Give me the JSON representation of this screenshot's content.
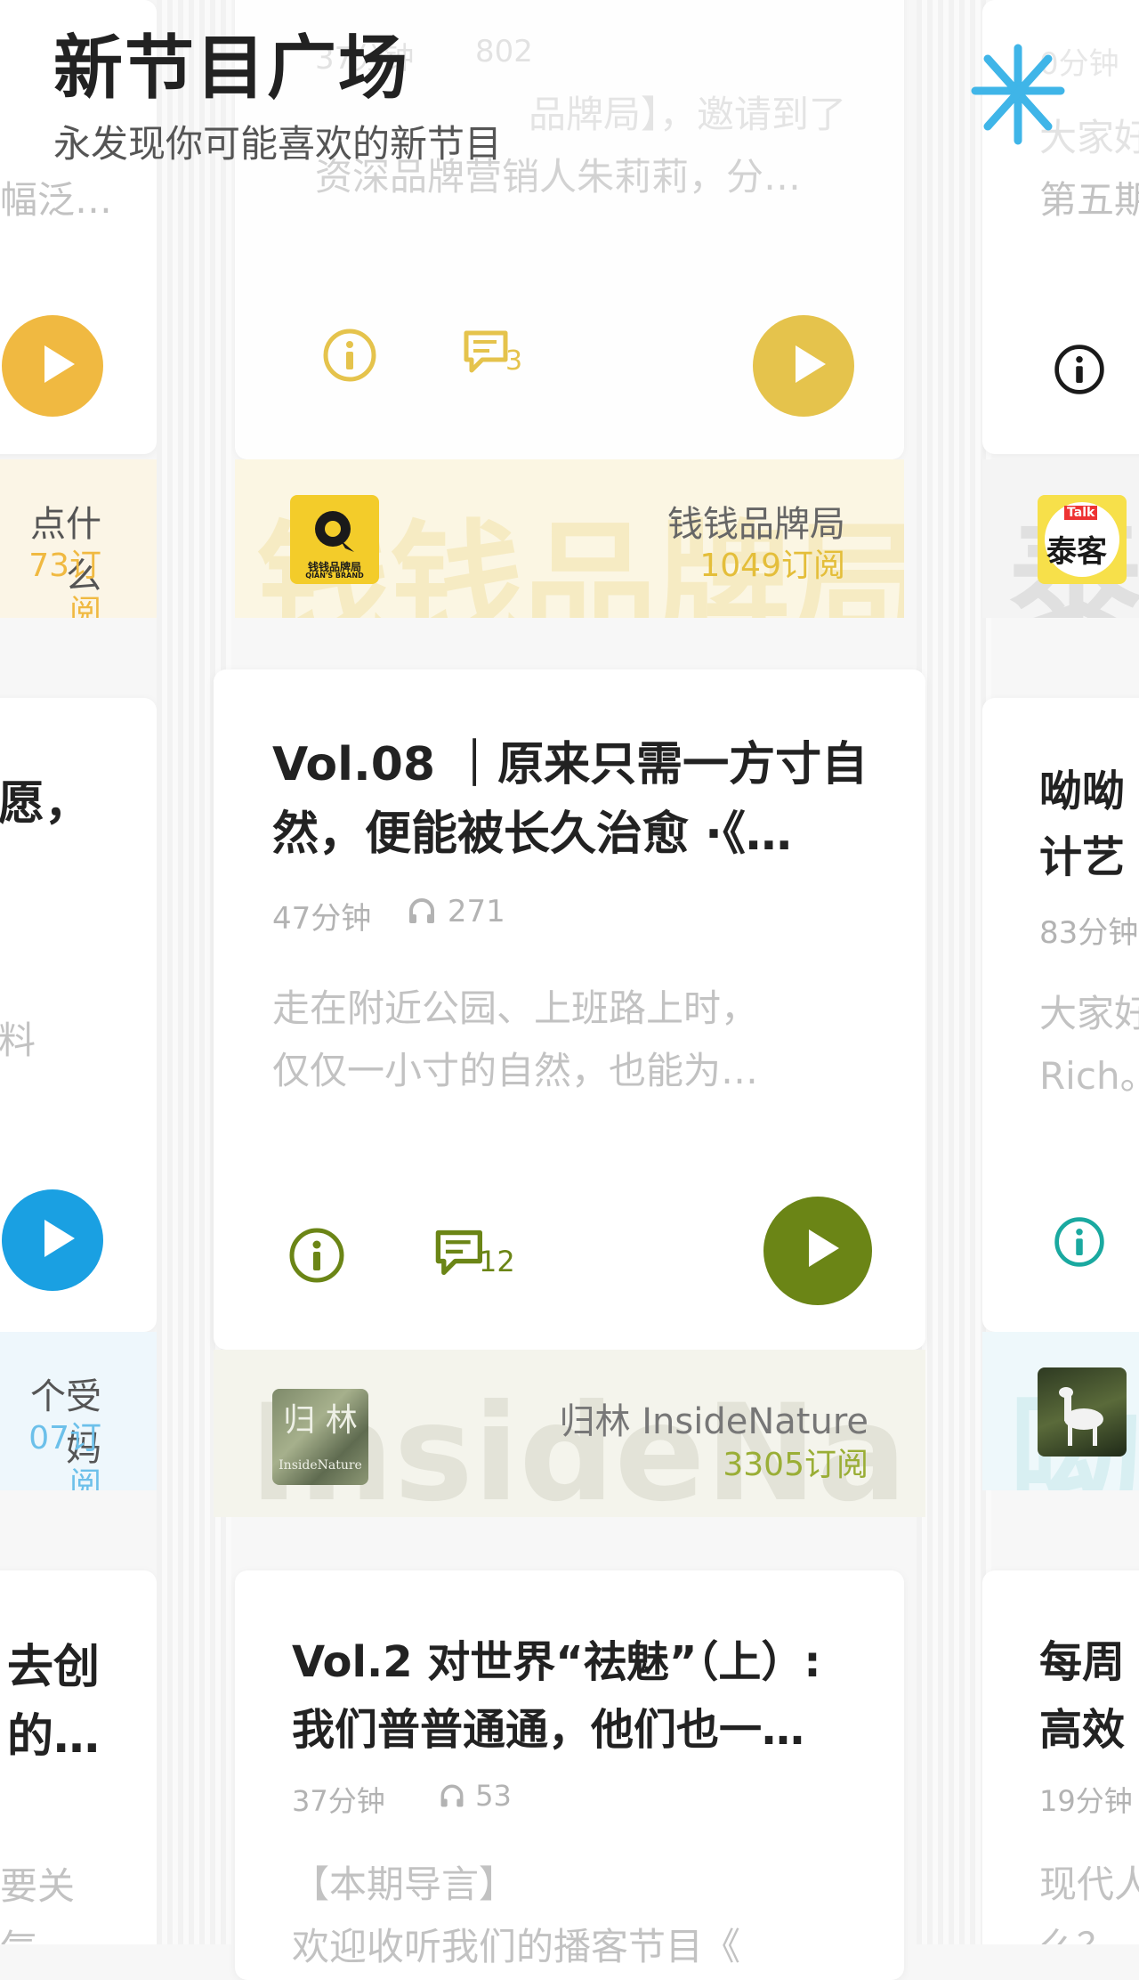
{
  "header": {
    "title": "新节目广场",
    "subtitle": "永发现你可能喜欢的新节目",
    "logo_icon": "asterisk-icon"
  },
  "colors": {
    "yellow_brand": "#e4be3a",
    "orange_play": "#f0b941",
    "olive_brand": "#6b8516",
    "blue_play": "#1aa0e2",
    "teal_icon": "#1aa9a0",
    "logo_blue": "#3fb5e8"
  },
  "center_column": {
    "top_card": {
      "meta_duration": "37分钟",
      "meta_plays": "802",
      "desc_line1": "品牌局】，邀请到了",
      "desc_line2": "资深品牌营销人朱莉莉，分…",
      "comments": "3"
    },
    "podcast1": {
      "name": "钱钱品牌局",
      "subs": "1049订阅",
      "watermark": "钱钱品牌局",
      "cover_label": "钱钱品牌局",
      "cover_sub": "QIAN'S BRAND"
    },
    "card1": {
      "title_line1": "Vol.08 ｜原来只需一方寸自",
      "title_line2": "然，便能被长久治愈 ·《…",
      "duration": "47分钟",
      "plays": "271",
      "desc_line1": "走在附近公园、上班路上时，",
      "desc_line2": "仅仅一小寸的自然，也能为…",
      "comments": "12"
    },
    "podcast2": {
      "name": "归林 InsideNature",
      "subs": "3305订阅",
      "watermark": "InsideNa",
      "cover_label": "归 林",
      "cover_sub": "InsideNature"
    },
    "card2": {
      "title_line1": "Vol.2 对世界“祛魅”（上）:",
      "title_line2": "我们普普通通，他们也一…",
      "duration": "37分钟",
      "plays": "53",
      "desc_line1": "【本期导言】",
      "desc_line2": "欢迎收听我们的播客节目《"
    }
  },
  "left_column": {
    "top_desc": "幅泛…",
    "podcast1_name": "点什么",
    "podcast1_subs": "73订阅",
    "card1_title": "愿，",
    "card1_desc": "料",
    "podcast2_name": "个受妈",
    "podcast2_subs": "07订阅",
    "card2_title_line1": "去创",
    "card2_title_line2": "的…",
    "card2_desc_line1": "要关",
    "card2_desc_line2": "气"
  },
  "right_column": {
    "top_meta": "0分钟",
    "top_desc_line1": "大家好",
    "top_desc_line2": "第五期",
    "podcast1_cover": "泰客",
    "podcast1_cover_tag": "Talk",
    "podcast1_watermark": "泰",
    "card1_title_line1": "呦呦",
    "card1_title_line2": "计艺",
    "card1_meta": "83分钟",
    "card1_desc_line1": "大家好",
    "card1_desc_line2": "Rich。",
    "podcast2_watermark": "呦",
    "card2_title_line1": "每周",
    "card2_title_line2": "高效",
    "card2_meta": "19分钟",
    "card2_desc_line1": "现代人",
    "card2_desc_line2": "么？"
  }
}
